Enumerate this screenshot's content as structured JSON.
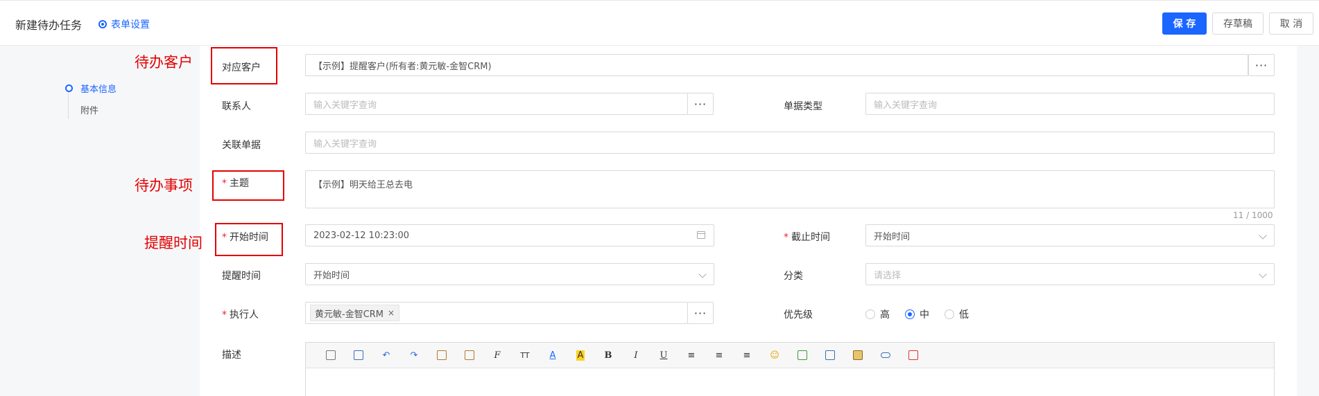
{
  "header": {
    "title": "新建待办任务",
    "form_settings": "表单设置",
    "save": "保 存",
    "draft": "存草稿",
    "cancel": "取 消"
  },
  "anchor_nav": {
    "items": [
      "基本信息",
      "附件"
    ],
    "active": "基本信息"
  },
  "form": {
    "customer": {
      "label": "对应客户",
      "value": "【示例】提醒客户(所有者:黄元敏-金智CRM)"
    },
    "contact": {
      "label": "联系人",
      "placeholder": "输入关键字查询"
    },
    "doc_type": {
      "label": "单据类型",
      "placeholder": "输入关键字查询"
    },
    "related_doc": {
      "label": "关联单据",
      "placeholder": "输入关键字查询"
    },
    "subject": {
      "label": "主题",
      "value": "【示例】明天给王总去电",
      "counter": "11 / 1000"
    },
    "start_time": {
      "label": "开始时间",
      "value": "2023-02-12 10:23:00"
    },
    "end_time": {
      "label": "截止时间",
      "value": "开始时间"
    },
    "remind_time": {
      "label": "提醒时间",
      "value": "开始时间"
    },
    "category": {
      "label": "分类",
      "placeholder": "请选择"
    },
    "executor": {
      "label": "执行人",
      "tag": "黄元敏-金智CRM",
      "tag_close": "×"
    },
    "priority": {
      "label": "优先级",
      "options": [
        "高",
        "中",
        "低"
      ],
      "selected": "中"
    },
    "description": {
      "label": "描述"
    },
    "ellipsis": "···"
  },
  "toolbar_text": {
    "bold": "B",
    "italic": "I",
    "underline": "U",
    "font": "F",
    "size": "TT",
    "color_a": "A",
    "bg_a": "A",
    "smile": "☺"
  },
  "annotations": {
    "customer": "待办客户",
    "subject": "待办事项",
    "remind": "提醒时间"
  },
  "colors": {
    "primary": "#1a66ff",
    "annotation": "#e30000",
    "required": "#f5222d"
  }
}
